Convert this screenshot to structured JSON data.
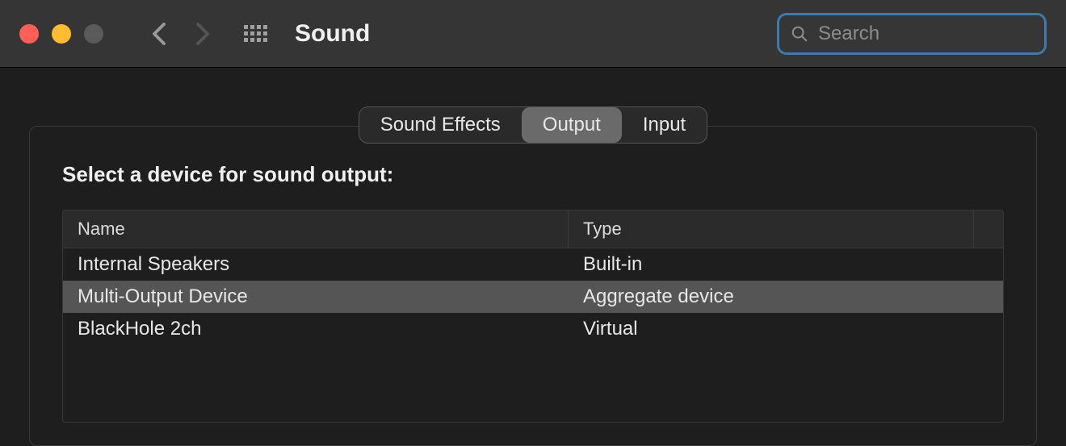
{
  "window": {
    "title": "Sound"
  },
  "search": {
    "placeholder": "Search",
    "value": ""
  },
  "tabs": [
    {
      "label": "Sound Effects",
      "active": false
    },
    {
      "label": "Output",
      "active": true
    },
    {
      "label": "Input",
      "active": false
    }
  ],
  "section": {
    "label": "Select a device for sound output:"
  },
  "table": {
    "columns": {
      "name": "Name",
      "type": "Type"
    },
    "rows": [
      {
        "name": "Internal Speakers",
        "type": "Built-in",
        "selected": false
      },
      {
        "name": "Multi-Output Device",
        "type": "Aggregate device",
        "selected": true
      },
      {
        "name": "BlackHole 2ch",
        "type": "Virtual",
        "selected": false
      }
    ]
  }
}
